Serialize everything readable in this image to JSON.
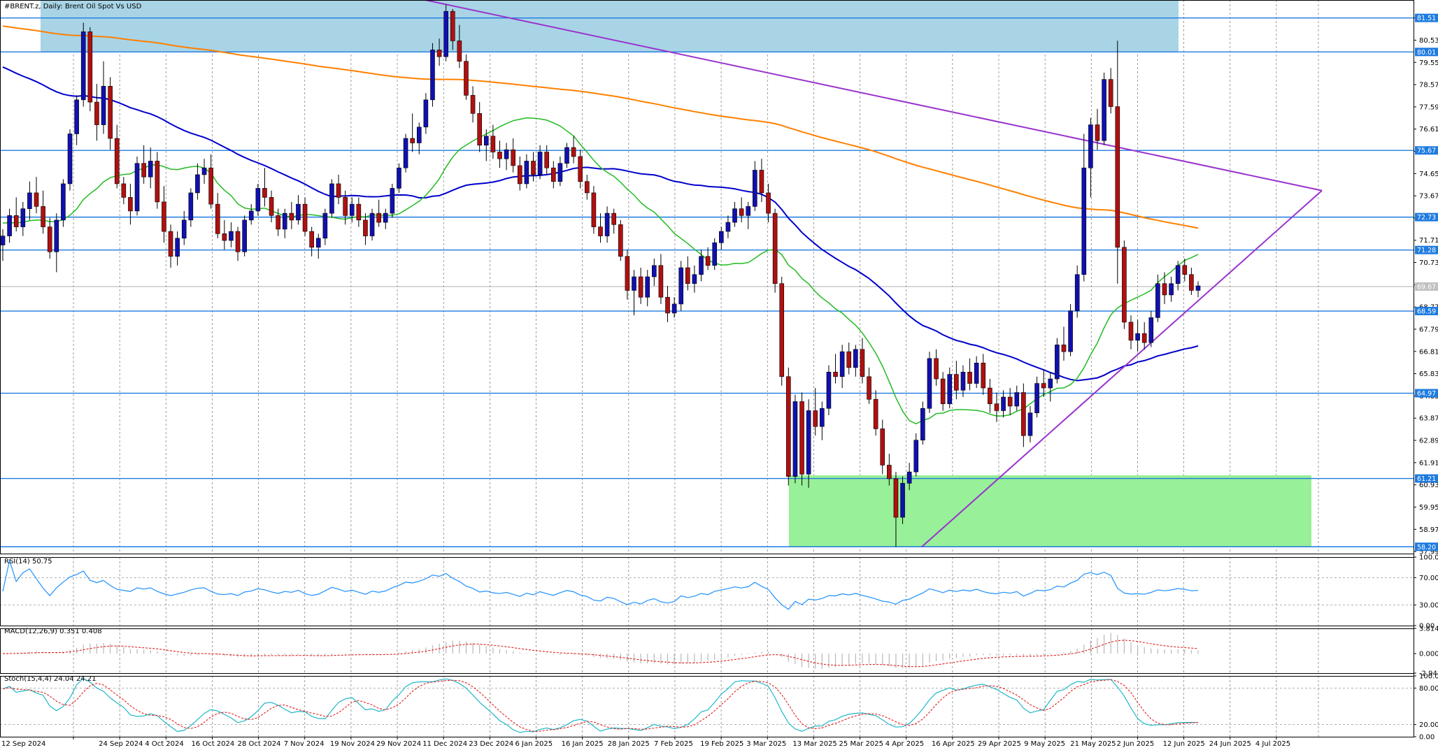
{
  "chart_data": {
    "type": "candlestick",
    "title": "#BRENT.z, Daily:  Brent Oil Spot Vs USD",
    "price_axis": {
      "ylim": [
        57.9,
        82.3
      ],
      "ticks": [
        "81.51",
        "80.53",
        "79.55",
        "78.57",
        "77.59",
        "76.61",
        "75.63",
        "74.65",
        "73.67",
        "72.69",
        "71.71",
        "70.73",
        "69.75",
        "68.77",
        "67.79",
        "66.81",
        "65.83",
        "64.85",
        "63.87",
        "62.89",
        "61.91",
        "60.93",
        "59.95",
        "58.97",
        "57.99"
      ]
    },
    "date_ticks": [
      "12 Sep 2024",
      "24 Sep 2024",
      "4 Oct 2024",
      "16 Oct 2024",
      "28 Oct 2024",
      "7 Nov 2024",
      "19 Nov 2024",
      "29 Nov 2024",
      "11 Dec 2024",
      "23 Dec 2024",
      "6 Jan 2025",
      "16 Jan 2025",
      "28 Jan 2025",
      "7 Feb 2025",
      "19 Feb 2025",
      "3 Mar 2025",
      "13 Mar 2025",
      "25 Mar 2025",
      "4 Apr 2025",
      "16 Apr 2025",
      "29 Apr 2025",
      "9 May 2025",
      "21 May 2025",
      "2 Jun 2025",
      "12 Jun 2025",
      "24 Jun 2025",
      "4 Jul 2025"
    ],
    "horizontal_levels": [
      "81.51",
      "80.01",
      "75.67",
      "72.73",
      "71.28",
      "68.59",
      "64.97",
      "61.21",
      "58.20"
    ],
    "current_price": "69.67",
    "candles": [
      [
        71.5,
        72.2,
        70.8,
        71.9
      ],
      [
        71.9,
        73.1,
        71.6,
        72.8
      ],
      [
        72.8,
        73.6,
        72.1,
        72.3
      ],
      [
        72.3,
        73.4,
        71.9,
        73.1
      ],
      [
        73.1,
        74.3,
        72.6,
        73.8
      ],
      [
        73.8,
        74.5,
        72.9,
        73.2
      ],
      [
        73.2,
        73.9,
        72.0,
        72.3
      ],
      [
        72.3,
        72.7,
        70.9,
        71.2
      ],
      [
        71.2,
        72.9,
        70.3,
        72.6
      ],
      [
        72.6,
        74.4,
        72.3,
        74.2
      ],
      [
        74.2,
        76.6,
        73.9,
        76.4
      ],
      [
        76.4,
        78.1,
        75.9,
        77.9
      ],
      [
        77.9,
        81.3,
        77.6,
        80.9
      ],
      [
        80.9,
        81.1,
        77.4,
        77.8
      ],
      [
        77.8,
        78.6,
        76.1,
        76.8
      ],
      [
        76.8,
        79.6,
        76.4,
        78.5
      ],
      [
        78.5,
        78.9,
        75.7,
        76.2
      ],
      [
        76.2,
        76.8,
        74.0,
        74.2
      ],
      [
        74.2,
        74.5,
        73.3,
        73.6
      ],
      [
        73.6,
        74.2,
        72.4,
        73.0
      ],
      [
        73.0,
        75.4,
        72.8,
        75.1
      ],
      [
        75.1,
        75.9,
        74.2,
        74.5
      ],
      [
        74.5,
        75.8,
        74.0,
        75.2
      ],
      [
        75.2,
        75.6,
        73.1,
        73.4
      ],
      [
        73.4,
        74.1,
        71.6,
        72.1
      ],
      [
        72.1,
        72.4,
        70.5,
        71.0
      ],
      [
        71.0,
        72.1,
        70.6,
        71.8
      ],
      [
        71.8,
        73.0,
        71.5,
        72.6
      ],
      [
        72.6,
        74.0,
        72.3,
        73.8
      ],
      [
        73.8,
        75.1,
        73.5,
        74.6
      ],
      [
        74.6,
        75.3,
        74.2,
        74.9
      ],
      [
        74.9,
        75.5,
        73.1,
        73.3
      ],
      [
        73.3,
        73.8,
        71.8,
        72.0
      ],
      [
        72.0,
        72.6,
        71.3,
        71.7
      ],
      [
        71.7,
        72.5,
        71.4,
        72.1
      ],
      [
        72.1,
        72.3,
        70.8,
        71.2
      ],
      [
        71.2,
        72.8,
        71.0,
        72.6
      ],
      [
        72.6,
        73.3,
        72.4,
        73.0
      ],
      [
        73.0,
        74.2,
        72.8,
        74.0
      ],
      [
        74.0,
        74.9,
        73.2,
        73.6
      ],
      [
        73.6,
        73.9,
        72.5,
        72.8
      ],
      [
        72.8,
        73.1,
        71.9,
        72.2
      ],
      [
        72.2,
        73.1,
        71.8,
        72.9
      ],
      [
        72.9,
        73.4,
        72.2,
        72.6
      ],
      [
        72.6,
        73.7,
        72.4,
        73.3
      ],
      [
        73.3,
        73.6,
        71.9,
        72.1
      ],
      [
        72.1,
        72.3,
        71.0,
        71.4
      ],
      [
        71.4,
        72.0,
        70.9,
        71.8
      ],
      [
        71.8,
        73.1,
        71.5,
        72.9
      ],
      [
        72.9,
        74.4,
        72.7,
        74.2
      ],
      [
        74.2,
        74.6,
        73.3,
        73.6
      ],
      [
        73.6,
        73.9,
        72.4,
        72.8
      ],
      [
        72.8,
        73.6,
        72.5,
        73.3
      ],
      [
        73.3,
        73.6,
        72.3,
        72.6
      ],
      [
        72.6,
        72.9,
        71.5,
        71.9
      ],
      [
        71.9,
        73.1,
        71.7,
        72.9
      ],
      [
        72.9,
        73.5,
        72.3,
        72.5
      ],
      [
        72.5,
        73.1,
        72.2,
        72.9
      ],
      [
        72.9,
        74.2,
        72.7,
        74.0
      ],
      [
        74.0,
        75.1,
        73.8,
        74.9
      ],
      [
        74.9,
        76.4,
        74.7,
        76.2
      ],
      [
        76.2,
        77.3,
        75.6,
        76.0
      ],
      [
        76.0,
        76.9,
        75.5,
        76.7
      ],
      [
        76.7,
        78.2,
        76.4,
        77.9
      ],
      [
        77.9,
        80.4,
        77.6,
        80.1
      ],
      [
        80.1,
        80.6,
        79.4,
        79.8
      ],
      [
        79.8,
        82.1,
        79.6,
        81.8
      ],
      [
        81.8,
        81.9,
        80.1,
        80.5
      ],
      [
        80.5,
        81.2,
        79.3,
        79.6
      ],
      [
        79.6,
        79.9,
        77.9,
        78.1
      ],
      [
        78.1,
        78.5,
        76.9,
        77.3
      ],
      [
        77.3,
        77.8,
        75.6,
        75.9
      ],
      [
        75.9,
        76.6,
        75.2,
        76.3
      ],
      [
        76.3,
        76.8,
        75.3,
        75.6
      ],
      [
        75.6,
        76.1,
        74.9,
        75.3
      ],
      [
        75.3,
        76.0,
        74.8,
        75.7
      ],
      [
        75.7,
        76.2,
        74.7,
        75.0
      ],
      [
        75.0,
        75.4,
        73.9,
        74.2
      ],
      [
        74.2,
        75.5,
        74.0,
        75.2
      ],
      [
        75.2,
        75.6,
        74.3,
        74.6
      ],
      [
        74.6,
        75.9,
        74.4,
        75.6
      ],
      [
        75.6,
        75.9,
        74.6,
        74.9
      ],
      [
        74.9,
        75.2,
        74.0,
        74.3
      ],
      [
        74.3,
        75.4,
        74.1,
        75.1
      ],
      [
        75.1,
        76.0,
        74.9,
        75.8
      ],
      [
        75.8,
        76.3,
        75.1,
        75.4
      ],
      [
        75.4,
        75.7,
        74.0,
        74.3
      ],
      [
        74.3,
        74.6,
        73.5,
        73.8
      ],
      [
        73.8,
        74.1,
        72.0,
        72.3
      ],
      [
        72.3,
        72.9,
        71.6,
        71.9
      ],
      [
        71.9,
        73.2,
        71.6,
        72.9
      ],
      [
        72.9,
        73.1,
        72.0,
        72.4
      ],
      [
        72.4,
        72.6,
        70.8,
        71.0
      ],
      [
        71.0,
        71.3,
        69.1,
        69.5
      ],
      [
        69.5,
        70.4,
        68.4,
        70.1
      ],
      [
        70.1,
        70.5,
        68.9,
        69.2
      ],
      [
        69.2,
        70.4,
        68.8,
        70.1
      ],
      [
        70.1,
        70.9,
        69.7,
        70.6
      ],
      [
        70.6,
        71.1,
        68.9,
        69.2
      ],
      [
        69.2,
        69.7,
        68.1,
        68.5
      ],
      [
        68.5,
        69.2,
        68.3,
        68.9
      ],
      [
        68.9,
        70.8,
        68.6,
        70.5
      ],
      [
        70.5,
        71.0,
        69.5,
        69.8
      ],
      [
        69.8,
        70.6,
        69.4,
        70.2
      ],
      [
        70.2,
        71.3,
        69.9,
        71.0
      ],
      [
        71.0,
        71.4,
        70.4,
        70.6
      ],
      [
        70.6,
        71.8,
        70.4,
        71.6
      ],
      [
        71.6,
        72.3,
        71.3,
        72.1
      ],
      [
        72.1,
        72.8,
        71.8,
        72.5
      ],
      [
        72.5,
        73.4,
        72.3,
        73.1
      ],
      [
        73.1,
        73.6,
        72.5,
        72.8
      ],
      [
        72.8,
        73.4,
        72.2,
        73.2
      ],
      [
        73.2,
        75.2,
        73.0,
        74.8
      ],
      [
        74.8,
        75.3,
        73.4,
        73.8
      ],
      [
        73.8,
        74.2,
        72.5,
        72.9
      ],
      [
        72.9,
        73.1,
        69.4,
        69.8
      ],
      [
        69.8,
        70.1,
        65.3,
        65.7
      ],
      [
        65.7,
        66.1,
        60.9,
        61.3
      ],
      [
        61.3,
        64.9,
        61.0,
        64.6
      ],
      [
        64.6,
        65.0,
        60.9,
        61.4
      ],
      [
        61.4,
        64.7,
        60.8,
        64.2
      ],
      [
        64.2,
        65.2,
        63.1,
        63.5
      ],
      [
        63.5,
        64.6,
        62.9,
        64.3
      ],
      [
        64.3,
        66.2,
        64.0,
        65.9
      ],
      [
        65.9,
        66.7,
        65.4,
        65.7
      ],
      [
        65.7,
        67.1,
        65.2,
        66.8
      ],
      [
        66.8,
        67.2,
        65.8,
        66.1
      ],
      [
        66.1,
        67.1,
        65.7,
        66.9
      ],
      [
        66.9,
        67.4,
        65.4,
        65.7
      ],
      [
        65.7,
        66.1,
        64.5,
        64.7
      ],
      [
        64.7,
        65.1,
        63.1,
        63.4
      ],
      [
        63.4,
        63.8,
        61.4,
        61.8
      ],
      [
        61.8,
        62.3,
        60.9,
        61.2
      ],
      [
        61.2,
        61.5,
        58.2,
        59.5
      ],
      [
        59.5,
        61.3,
        59.2,
        61.0
      ],
      [
        61.0,
        61.9,
        60.7,
        61.5
      ],
      [
        61.5,
        63.2,
        61.3,
        62.9
      ],
      [
        62.9,
        64.6,
        62.7,
        64.3
      ],
      [
        64.3,
        66.8,
        64.1,
        66.5
      ],
      [
        66.5,
        66.9,
        65.3,
        65.6
      ],
      [
        65.6,
        65.9,
        64.2,
        64.5
      ],
      [
        64.5,
        66.1,
        64.3,
        65.8
      ],
      [
        65.8,
        66.4,
        64.7,
        65.1
      ],
      [
        65.1,
        66.2,
        64.8,
        65.9
      ],
      [
        65.9,
        66.5,
        65.1,
        65.4
      ],
      [
        65.4,
        66.6,
        65.2,
        66.3
      ],
      [
        66.3,
        66.7,
        64.9,
        65.2
      ],
      [
        65.2,
        65.6,
        64.1,
        64.5
      ],
      [
        64.5,
        65.0,
        63.7,
        64.2
      ],
      [
        64.2,
        65.1,
        63.9,
        64.8
      ],
      [
        64.8,
        65.2,
        64.0,
        64.4
      ],
      [
        64.4,
        65.3,
        64.2,
        65.0
      ],
      [
        65.0,
        65.4,
        62.6,
        63.1
      ],
      [
        63.1,
        64.4,
        62.8,
        64.1
      ],
      [
        64.1,
        65.7,
        63.9,
        65.4
      ],
      [
        65.4,
        66.0,
        64.8,
        65.2
      ],
      [
        65.2,
        65.9,
        64.6,
        65.6
      ],
      [
        65.6,
        67.4,
        65.4,
        67.1
      ],
      [
        67.1,
        67.9,
        66.4,
        66.8
      ],
      [
        66.8,
        68.9,
        66.6,
        68.6
      ],
      [
        68.6,
        70.6,
        68.3,
        70.2
      ],
      [
        70.2,
        76.4,
        69.9,
        74.9
      ],
      [
        74.9,
        77.1,
        73.6,
        76.8
      ],
      [
        76.8,
        77.5,
        75.7,
        76.1
      ],
      [
        76.1,
        79.1,
        75.9,
        78.8
      ],
      [
        78.8,
        79.3,
        77.3,
        77.6
      ],
      [
        77.6,
        80.5,
        69.8,
        71.4
      ],
      [
        71.4,
        71.7,
        67.8,
        68.1
      ],
      [
        68.1,
        68.4,
        66.9,
        67.3
      ],
      [
        67.3,
        68.2,
        66.8,
        67.6
      ],
      [
        67.6,
        68.1,
        66.9,
        67.2
      ],
      [
        67.2,
        68.6,
        67.0,
        68.3
      ],
      [
        68.3,
        70.2,
        68.1,
        69.8
      ],
      [
        69.8,
        70.3,
        68.9,
        69.3
      ],
      [
        69.3,
        70.1,
        69.0,
        69.8
      ],
      [
        69.8,
        70.8,
        69.5,
        70.6
      ],
      [
        70.6,
        70.9,
        69.9,
        70.2
      ],
      [
        70.2,
        70.5,
        69.3,
        69.5
      ],
      [
        69.5,
        69.9,
        69.2,
        69.7
      ]
    ],
    "indicators": [
      {
        "title": "RSI(14) 50.75",
        "ylim": [
          0,
          100
        ],
        "ticks": [
          "100.00",
          "70.00",
          "30.00",
          "0.00"
        ]
      },
      {
        "title": "MACD(12,26,9) 0.351 0.408",
        "ylim": [
          -2.948,
          3.814
        ],
        "ticks": [
          "3.814",
          "0.000",
          "-2.948"
        ]
      },
      {
        "title": "Stoch(15,4,4) 24.04 24.21",
        "ylim": [
          0,
          100
        ],
        "ticks": [
          "100.00",
          "80.00",
          "20.00",
          "0.00"
        ]
      }
    ],
    "colors": {
      "bull": "#1010b0",
      "bear": "#b01010",
      "ma_slow": "#ff8000",
      "ma_mid": "#0000cc",
      "ma_fast": "#22bb22",
      "trendline": "#9933cc",
      "level": "#1e7be0"
    }
  }
}
